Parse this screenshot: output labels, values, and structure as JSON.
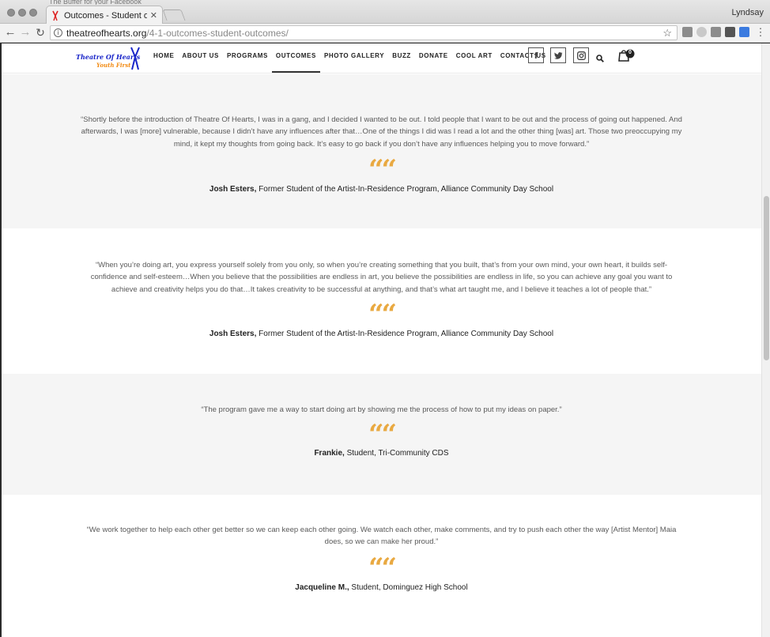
{
  "browser": {
    "background_tab_text": "The Buffer for your Facebook",
    "tab_title": "Outcomes - Student outcomes",
    "tab_close": "✕",
    "profile_name": "Lyndsay",
    "url_host": "theatreofhearts.org",
    "url_path": "/4-1-outcomes-student-outcomes/",
    "icons": [
      "back-arrow-icon",
      "forward-arrow-icon",
      "reload-icon",
      "info-icon",
      "star-icon",
      "camera-icon",
      "extension-icon",
      "menu-dots-icon"
    ]
  },
  "site": {
    "logo": {
      "line1": "Theatre Of Hearts",
      "line2": "Youth First"
    },
    "nav": [
      "HOME",
      "ABOUT US",
      "PROGRAMS",
      "OUTCOMES",
      "PHOTO GALLERY",
      "BUZZ",
      "DONATE",
      "COOL ART",
      "CONTACT US"
    ],
    "active_nav": "OUTCOMES",
    "social": {
      "facebook": "f",
      "twitter": "twitter-icon",
      "instagram": "instagram-icon"
    },
    "cart_count": "0",
    "accent_color": "#e9a941"
  },
  "quotes": [
    {
      "text": "“Shortly before the introduction of Theatre Of Hearts, I was in a gang, and I decided I wanted to be out. I told people that I want to be out and the process of going out happened. And afterwards, I was [more] vulnerable, because I didn’t have any influences after that…One of the things I did was I read a lot and the other thing [was] art. Those two preoccupying my mind, it kept my thoughts from going back. It’s easy to go back if you don’t have any influences helping you to move forward.”",
      "mark": "“",
      "name": "Josh Esters,",
      "role": "Former Student of the Artist-In-Residence Program, Alliance Community Day School"
    },
    {
      "text": "“When you’re doing art, you express yourself solely from you only, so when you’re creating something that you built, that’s from your own mind, your own heart, it builds self-confidence and self-esteem…When you believe that the possibilities are endless in art, you believe the possibilities are endless in life, so you can achieve any goal you want to achieve and creativity helps you do that…It takes creativity to be successful at anything, and that’s what art taught me, and I believe it teaches a lot of people that.”",
      "mark": "“",
      "name": "Josh Esters,",
      "role": "Former Student of the Artist-In-Residence Program, Alliance Community Day School"
    },
    {
      "text": "“The program gave me a way to start doing art by showing me the process of how to put my ideas on paper.”",
      "mark": "“",
      "name": "Frankie,",
      "role": "Student, Tri-Community CDS"
    },
    {
      "text": "“We work together to help each other get better so we can keep each other going. We watch each other, make comments, and try to push each other the way [Artist Mentor] Maia does, so we can make her proud.”",
      "mark": "“",
      "name": "Jacqueline M.,",
      "role": "Student, Dominguez High School"
    }
  ]
}
